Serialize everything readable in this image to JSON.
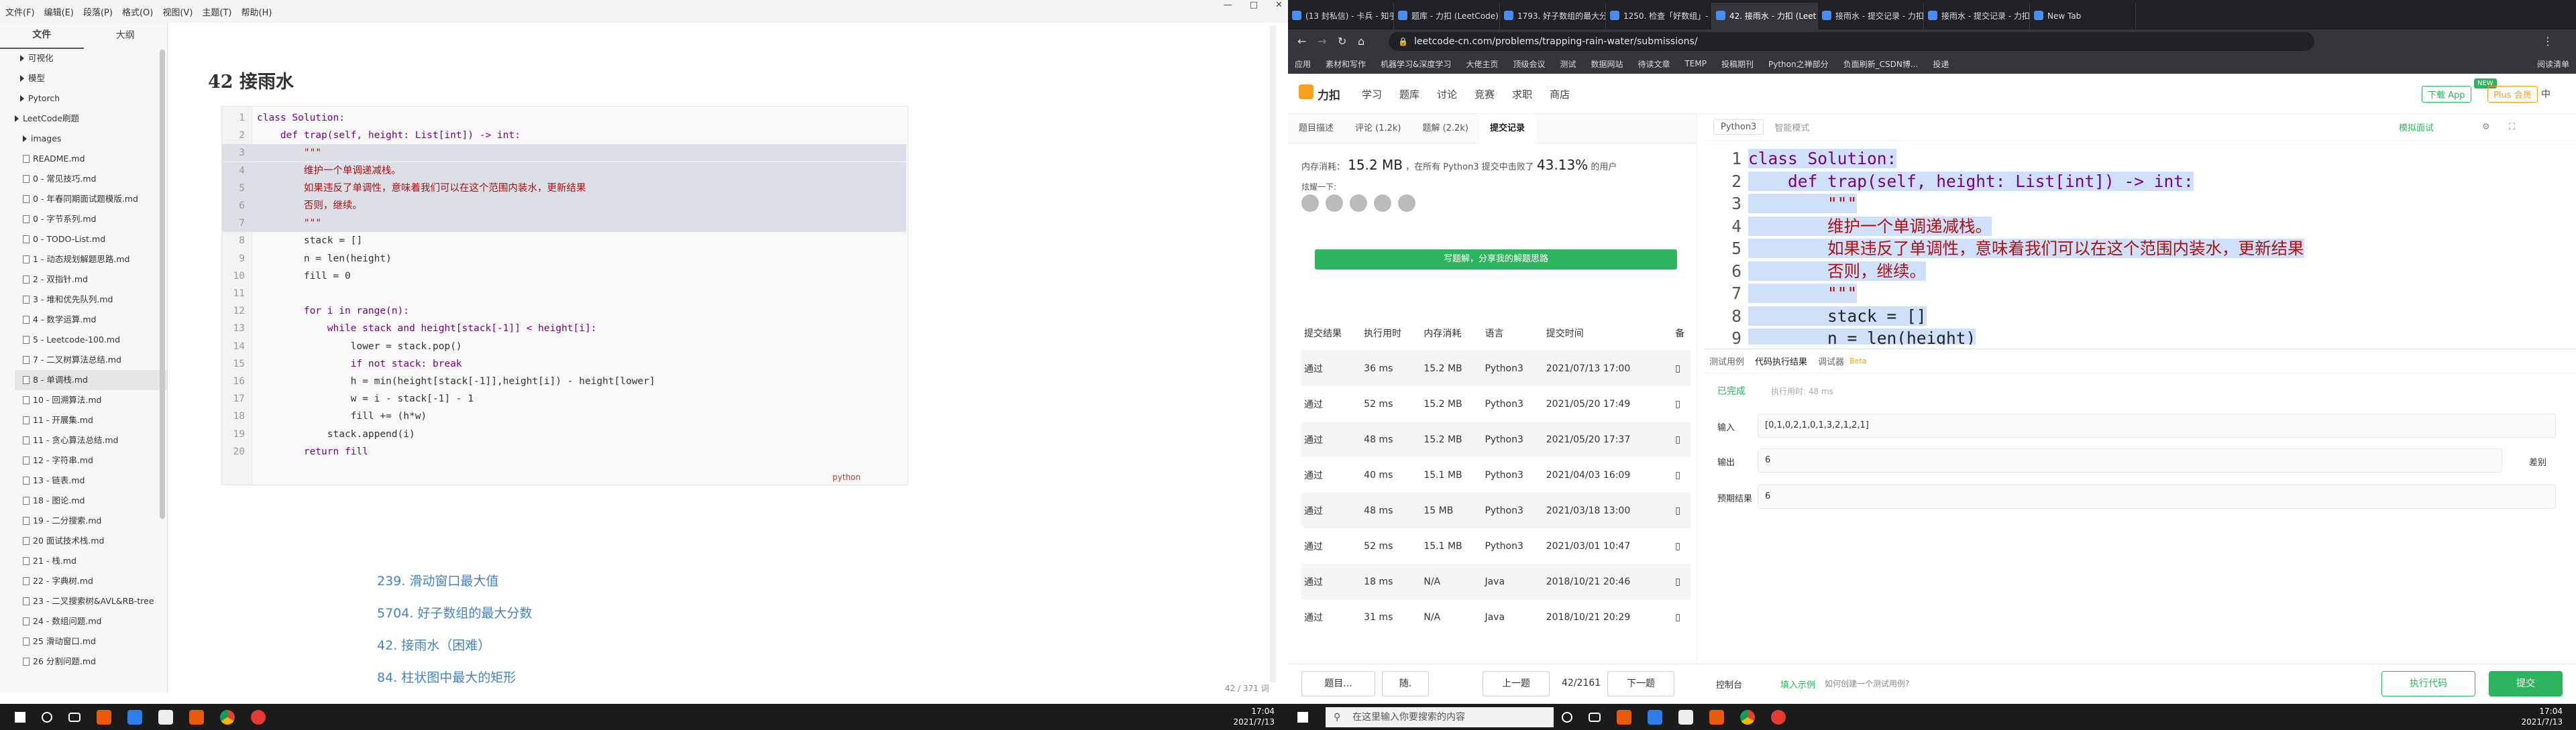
{
  "typora": {
    "menu": [
      "文件(F)",
      "编辑(E)",
      "段落(P)",
      "格式(O)",
      "视图(V)",
      "主题(T)",
      "帮助(H)"
    ],
    "sidebar_tabs": [
      "文件",
      "大纲"
    ],
    "files": [
      {
        "label": "可视化",
        "type": "folder"
      },
      {
        "label": "模型",
        "type": "folder"
      },
      {
        "label": "Pytorch",
        "type": "folder"
      },
      {
        "label": "LeetCode刷题",
        "type": "folder"
      },
      {
        "label": "images",
        "type": "folder"
      },
      {
        "label": "README.md",
        "type": "file"
      },
      {
        "label": "0 - 常见技巧.md",
        "type": "file"
      },
      {
        "label": "0 - 年春同期面试题模版.md",
        "type": "file"
      },
      {
        "label": "0 - 字节系列.md",
        "type": "file"
      },
      {
        "label": "0 - TODO-List.md",
        "type": "file"
      },
      {
        "label": "1 - 动态规划解题思路.md",
        "type": "file"
      },
      {
        "label": "2 - 双指针.md",
        "type": "file"
      },
      {
        "label": "3 - 堆和优先队列.md",
        "type": "file"
      },
      {
        "label": "4 - 数学运算.md",
        "type": "file"
      },
      {
        "label": "5 - Leetcode-100.md",
        "type": "file"
      },
      {
        "label": "7 - 二叉树算法总结.md",
        "type": "file"
      },
      {
        "label": "8 - 单调栈.md",
        "type": "file",
        "selected": true
      },
      {
        "label": "10 - 回溯算法.md",
        "type": "file"
      },
      {
        "label": "11 - 开展集.md",
        "type": "file"
      },
      {
        "label": "11 - 贪心算法总结.md",
        "type": "file"
      },
      {
        "label": "12 - 字符串.md",
        "type": "file"
      },
      {
        "label": "13 - 链表.md",
        "type": "file"
      },
      {
        "label": "18 - 图论.md",
        "type": "file"
      },
      {
        "label": "19 - 二分搜索.md",
        "type": "file"
      },
      {
        "label": "20 面试技术栈.md",
        "type": "file"
      },
      {
        "label": "21 - 栈.md",
        "type": "file"
      },
      {
        "label": "22 - 字典树.md",
        "type": "file"
      },
      {
        "label": "23 - 二叉搜索树&AVL&RB-tree",
        "type": "file"
      },
      {
        "label": "24 - 数组问题.md",
        "type": "file"
      },
      {
        "label": "25 滑动窗口.md",
        "type": "file"
      },
      {
        "label": "26 分割问题.md",
        "type": "file"
      }
    ],
    "doc_title": "42 接雨水",
    "code_lang": "python",
    "links": [
      "239. 滑动窗口最大值",
      "5704. 好子数组的最大分数",
      "42. 接雨水（困难）",
      "84. 柱状图中最大的矩形"
    ],
    "word_count": "42 / 371 词",
    "footer_icons": "<  />"
  },
  "code_lines": [
    "class Solution:",
    "    def trap(self, height: List[int]) -> int:",
    "        \"\"\"",
    "        维护一个单调递减栈。",
    "        如果违反了单调性，意味着我们可以在这个范围内装水，更新结果",
    "        否则，继续。",
    "        \"\"\"",
    "        stack = []",
    "        n = len(height)",
    "        fill = 0",
    "",
    "        for i in range(n):",
    "            while stack and height[stack[-1]] < height[i]:",
    "                lower = stack.pop()",
    "                if not stack: break",
    "                h = min(height[stack[-1]],height[i]) - height[lower]",
    "                w = i - stack[-1] - 1",
    "                fill += (h*w)",
    "            stack.append(i)",
    "        return fill"
  ],
  "taskbar_left": {
    "time": "17:04",
    "date": "2021/7/13"
  },
  "taskbar_right": {
    "search": "在这里输入你要搜索的内容",
    "time": "17:04",
    "date": "2021/7/13"
  },
  "chrome": {
    "tabs": [
      "(13 封私信) - 卡兵 - 知乎",
      "题库 - 力扣 (LeetCode) 全球",
      "1793. 好子数组的最大分数",
      "1250. 检查「好数组」- 力",
      "42. 接雨水 - 力扣 (Leet",
      "接雨水 - 提交记录 - 力扣",
      "接雨水 - 提交记录 - 力扣",
      "New Tab"
    ],
    "url": "leetcode-cn.com/problems/trapping-rain-water/submissions/",
    "bookmarks": [
      "应用",
      "素材和写作",
      "机器学习&深度学习",
      "大佬主页",
      "顶级会议",
      "测试",
      "数据网站",
      "待读文章",
      "TEMP",
      "投稿期刊",
      "Python之禅部分",
      "负面刷新_CSDN博...",
      "投递"
    ],
    "bookmark_right": "阅读清单"
  },
  "leetcode": {
    "logo": "力扣",
    "nav": [
      "学习",
      "题库",
      "讨论",
      "竞赛",
      "求职",
      "商店"
    ],
    "nav_badge": "NEW",
    "download_app": "下载 App",
    "plus": "Plus 会员",
    "lang_switch": "中",
    "left_tabs": [
      "题目描述",
      "评论 (1.2k)",
      "题解 (2.2k)",
      "提交记录"
    ],
    "memory_label": "内存消耗：",
    "memory_value": "15.2 MB",
    "memory_text": "，在所有 Python3 提交中击败了",
    "memory_pct": "43.13%",
    "memory_suffix": "的用户",
    "share_label": "炫耀一下:",
    "write_solution": "写题解，分享我的解题思路",
    "table_headers": [
      "提交结果",
      "执行用时",
      "内存消耗",
      "语言",
      "提交时间",
      "备"
    ],
    "submissions": [
      [
        "通过",
        "36 ms",
        "15.2 MB",
        "Python3",
        "2021/07/13 17:00"
      ],
      [
        "通过",
        "52 ms",
        "15.2 MB",
        "Python3",
        "2021/05/20 17:49"
      ],
      [
        "通过",
        "48 ms",
        "15.2 MB",
        "Python3",
        "2021/05/20 17:37"
      ],
      [
        "通过",
        "40 ms",
        "15.1 MB",
        "Python3",
        "2021/04/03 16:09"
      ],
      [
        "通过",
        "48 ms",
        "15 MB",
        "Python3",
        "2021/03/18 13:00"
      ],
      [
        "通过",
        "52 ms",
        "15.1 MB",
        "Python3",
        "2021/03/01 10:47"
      ],
      [
        "通过",
        "18 ms",
        "N/A",
        "Java",
        "2018/10/21 20:46"
      ],
      [
        "通过",
        "31 ms",
        "N/A",
        "Java",
        "2018/10/21 20:29"
      ]
    ],
    "lang": "Python3",
    "smart_mode": "智能模式",
    "mock_interview": "模拟面试",
    "console_tabs": [
      "测试用例",
      "代码执行结果",
      "调试器"
    ],
    "beta": "Beta",
    "status": "已完成",
    "exec_time": "执行用时: 48 ms",
    "input_label": "输入",
    "input_value": "[0,1,0,2,1,0,1,3,2,1,2,1]",
    "output_label": "输出",
    "output_value": "6",
    "expected_label": "预期结果",
    "expected_value": "6",
    "diff_label": "差别",
    "footer": {
      "problem_list": "题目...",
      "random": "随.",
      "prev": "上一题",
      "counter": "42/2161",
      "next": "下一题",
      "console": "控制台",
      "contribute": "贡献 i",
      "fill_example": "填入示例",
      "how_to": "如何创建一个测试用例?",
      "run": "执行代码",
      "submit": "提交"
    }
  }
}
